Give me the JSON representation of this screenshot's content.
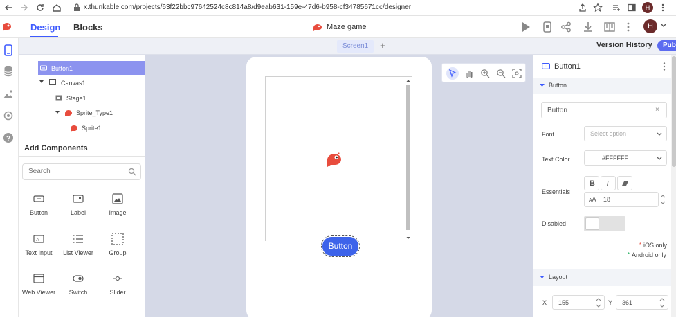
{
  "browser": {
    "url": "x.thunkable.com/projects/63f22bbc97642524c8c814a8/d9eab631-159e-47d6-b958-cf34785671cc/designer",
    "avatar_letter": "H"
  },
  "header": {
    "design_tab": "Design",
    "blocks_tab": "Blocks",
    "project_title": "Maze game",
    "avatar_letter": "H"
  },
  "screen_strip": {
    "screen_tab": "Screen1",
    "add_label": "+",
    "version_history": "Version History",
    "public_button": "Public"
  },
  "tree": {
    "items": [
      {
        "label": "Button1",
        "selected": true
      },
      {
        "label": "Canvas1"
      },
      {
        "label": "Stage1"
      },
      {
        "label": "Sprite_Type1"
      },
      {
        "label": "Sprite1"
      }
    ]
  },
  "components": {
    "title": "Add Components",
    "search_placeholder": "Search",
    "items": [
      {
        "label": "Button",
        "icon": "button-icon"
      },
      {
        "label": "Label",
        "icon": "label-icon"
      },
      {
        "label": "Image",
        "icon": "image-icon"
      },
      {
        "label": "Text Input",
        "icon": "text-input-icon"
      },
      {
        "label": "List Viewer",
        "icon": "list-viewer-icon"
      },
      {
        "label": "Group",
        "icon": "group-icon"
      },
      {
        "label": "Web Viewer",
        "icon": "web-viewer-icon"
      },
      {
        "label": "Switch",
        "icon": "switch-icon"
      },
      {
        "label": "Slider",
        "icon": "slider-icon"
      }
    ]
  },
  "phone": {
    "button_label": "Button"
  },
  "properties": {
    "component_name": "Button1",
    "section_button": "Button",
    "text_value": "Button",
    "clear_label": "×",
    "font_label": "Font",
    "font_placeholder": "Select option",
    "text_color_label": "Text Color",
    "text_color_value": "#FFFFFF",
    "essentials_label": "Essentials",
    "font_size_value": "18",
    "disabled_label": "Disabled",
    "ios_only": "iOS only",
    "android_only": "Android only",
    "section_layout": "Layout",
    "x_label": "X",
    "x_value": "155",
    "y_label": "Y",
    "y_value": "361"
  },
  "colors": {
    "accent": "#3d5afe",
    "selected_row": "#8c93ef",
    "canvas_bg": "#d5d9e7",
    "phone_button": "#3d63ea",
    "sprite": "#e84c3d",
    "public_button": "#5c6bf0"
  }
}
